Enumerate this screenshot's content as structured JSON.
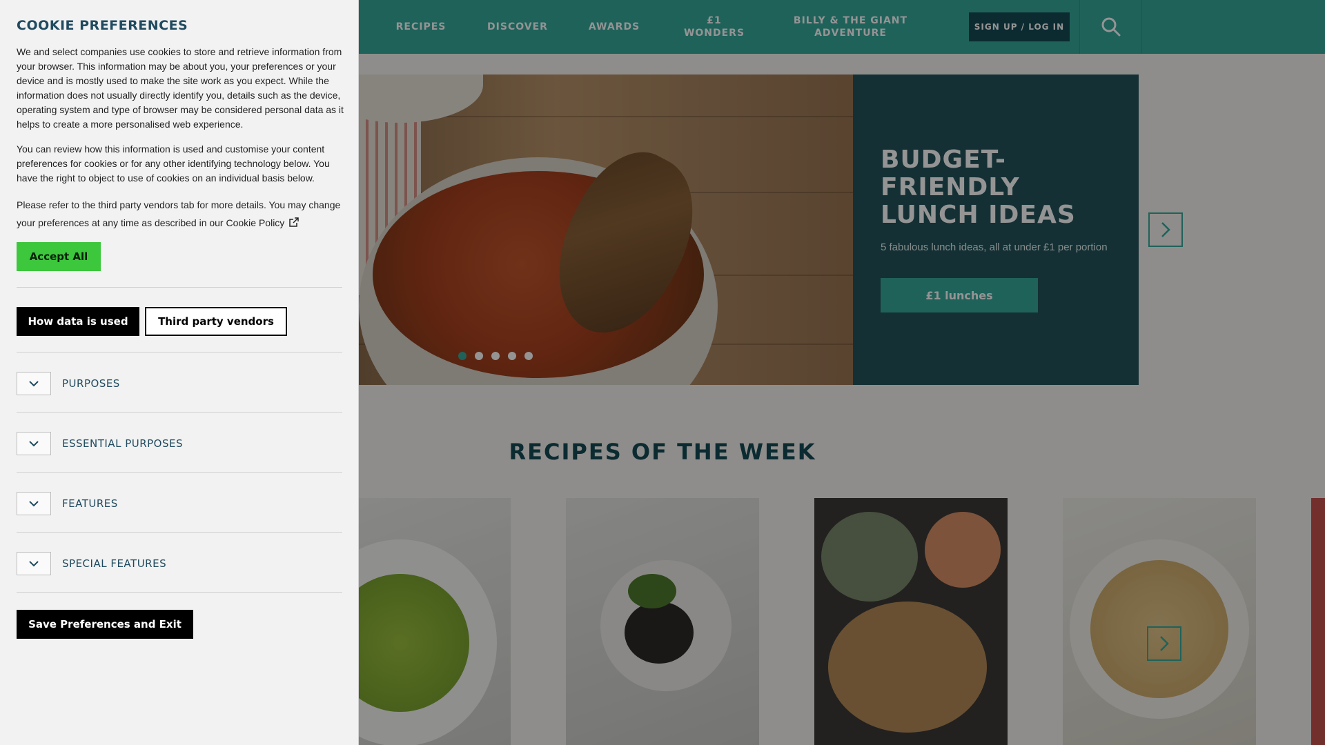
{
  "nav": {
    "items": [
      {
        "label": "RECIPES"
      },
      {
        "label": "DISCOVER"
      },
      {
        "label": "AWARDS"
      },
      {
        "label": "£1 WONDERS"
      },
      {
        "label": "BILLY & THE GIANT ADVENTURE"
      }
    ],
    "signup_label": "SIGN UP / LOG IN",
    "search_icon": "search-icon"
  },
  "hero": {
    "title": "BUDGET-FRIENDLY LUNCH IDEAS",
    "subtitle": "5 fabulous lunch ideas, all at under £1 per portion",
    "button_label": "£1 lunches",
    "slide_count": 5,
    "active_slide": 1
  },
  "recipes_section": {
    "title": "RECIPES OF THE WEEK"
  },
  "cookie_panel": {
    "title": "COOKIE PREFERENCES",
    "paragraph1": "We and select companies use cookies to store and retrieve information from your browser. This information may be about you, your preferences or your device and is mostly used to make the site work as you expect. While the information does not usually directly identify you, details such as the device, operating system and type of browser may be considered personal data as it helps to create a more personalised web experience.",
    "paragraph2": "You can review how this information is used and customise your content preferences for cookies or for any other identifying technology below. You have the right to object to use of cookies on an individual basis below.",
    "paragraph3": "Please refer to the third party vendors tab for more details. You may change your preferences at any time as described in our Cookie Policy",
    "accept_label": "Accept All",
    "tabs": [
      {
        "label": "How data is used"
      },
      {
        "label": "Third party vendors"
      }
    ],
    "sections": [
      {
        "label": "PURPOSES"
      },
      {
        "label": "ESSENTIAL PURPOSES"
      },
      {
        "label": "FEATURES"
      },
      {
        "label": "SPECIAL FEATURES"
      }
    ],
    "save_label": "Save Preferences and Exit"
  },
  "colors": {
    "brand_teal": "#36a99c",
    "dark_teal": "#23545a",
    "accept_green": "#3cc73c"
  }
}
